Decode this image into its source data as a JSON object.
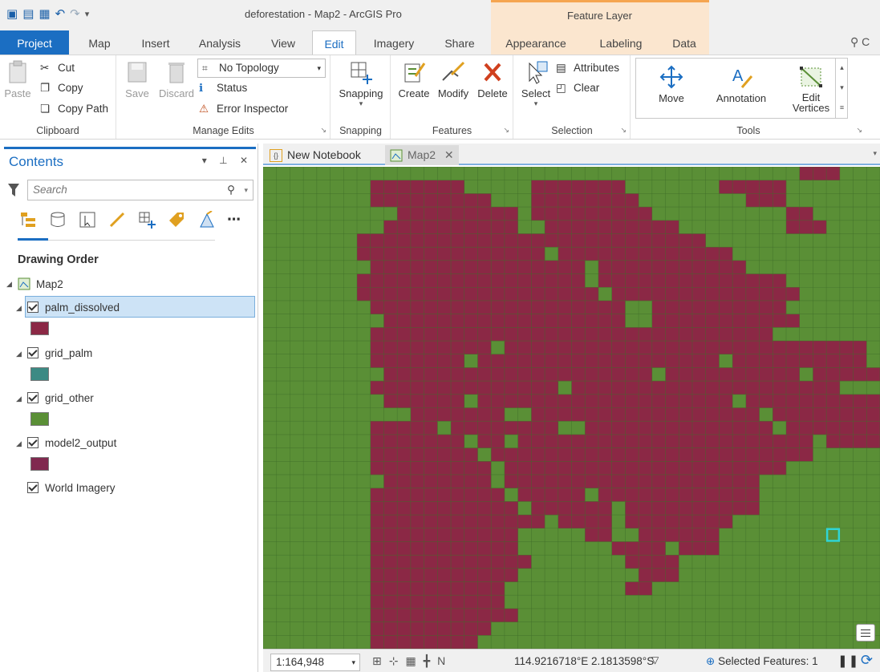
{
  "window": {
    "title": "deforestation - Map2 - ArcGIS Pro",
    "context_tab_group": "Feature Layer"
  },
  "tabs": [
    {
      "label": "Project"
    },
    {
      "label": "Map"
    },
    {
      "label": "Insert"
    },
    {
      "label": "Analysis"
    },
    {
      "label": "View"
    },
    {
      "label": "Edit"
    },
    {
      "label": "Imagery"
    },
    {
      "label": "Share"
    },
    {
      "label": "Appearance"
    },
    {
      "label": "Labeling"
    },
    {
      "label": "Data"
    }
  ],
  "ribbon": {
    "clipboard": {
      "paste": "Paste",
      "cut": "Cut",
      "copy": "Copy",
      "copy_path": "Copy Path",
      "label": "Clipboard"
    },
    "manage_edits": {
      "save": "Save",
      "discard": "Discard",
      "topology": "No Topology",
      "status": "Status",
      "error_inspector": "Error Inspector",
      "label": "Manage Edits"
    },
    "snapping": {
      "button": "Snapping",
      "label": "Snapping"
    },
    "features": {
      "create": "Create",
      "modify": "Modify",
      "delete": "Delete",
      "label": "Features"
    },
    "selection": {
      "select": "Select",
      "attributes": "Attributes",
      "clear": "Clear",
      "label": "Selection"
    },
    "tools": {
      "move": "Move",
      "annotation": "Annotation",
      "edit_vertices_1": "Edit",
      "edit_vertices_2": "Vertices",
      "label": "Tools"
    }
  },
  "contents": {
    "title": "Contents",
    "search_placeholder": "Search",
    "drawing_order": "Drawing Order",
    "map": "Map2",
    "layers": [
      {
        "name": "palm_dissolved",
        "swatch": "#8b2845"
      },
      {
        "name": "grid_palm",
        "swatch": "#3c8a84"
      },
      {
        "name": "grid_other",
        "swatch": "#5a8f36"
      },
      {
        "name": "model2_output",
        "swatch": "#80294f"
      },
      {
        "name": "World Imagery"
      }
    ]
  },
  "map_tabs": [
    {
      "label": "New Notebook"
    },
    {
      "label": "Map2",
      "close": "✕"
    }
  ],
  "status": {
    "scale": "1:164,948",
    "coordinates": "114.9216718°E 2.1813598°S",
    "selected": "Selected Features: 1"
  },
  "colors": {
    "palm": "#8b2845",
    "other": "#5a8f36",
    "grid": "#3e6e2a",
    "highlight": "#2fd5d5",
    "accent": "#1b6ec2"
  },
  "map_grid": {
    "cols": 46,
    "rows": 36,
    "palm_cells": [
      "........................................###...",
      "........#######.....#######.......#####.......",
      "........#########...########........###.......",
      "..........#########.#########..........##.....",
      ".........##########..##########........###....",
      ".......##########################.............",
      ".......##############.#############...........",
      "........################.###########.........",
      ".......#################.##############.......",
      ".......##################.##############......",
      "........###################..##########.......",
      ".........##################..###########......",
      "........##############################........",
      "........#########.###########################.",
      "........#######.##################.##########.",
      ".........####################.##########.#####",
      "........##############.####################...",
      ".........######.###################.##########",
      "...........#######..#################.########",
      "........#####.########..##############.#######",
      "........#######.##.######################.####",
      "........########.########################.....",
      "........#########.#####################.......",
      ".........########.###################.........",
      "........##########.#####.############.........",
      "........###########.######.##########.........",
      "........#############.####.########...........",
      "........###########.....##..######............",
      "........###########.......####.###............",
      "........############.......####...............",
      "........###########.........###...............",
      "........##########.........##.................",
      "........##########.............................",
      "........###########...........................",
      "........#########.............................",
      "........########.............................."
    ],
    "highlight_cell": [
      42,
      27
    ]
  }
}
